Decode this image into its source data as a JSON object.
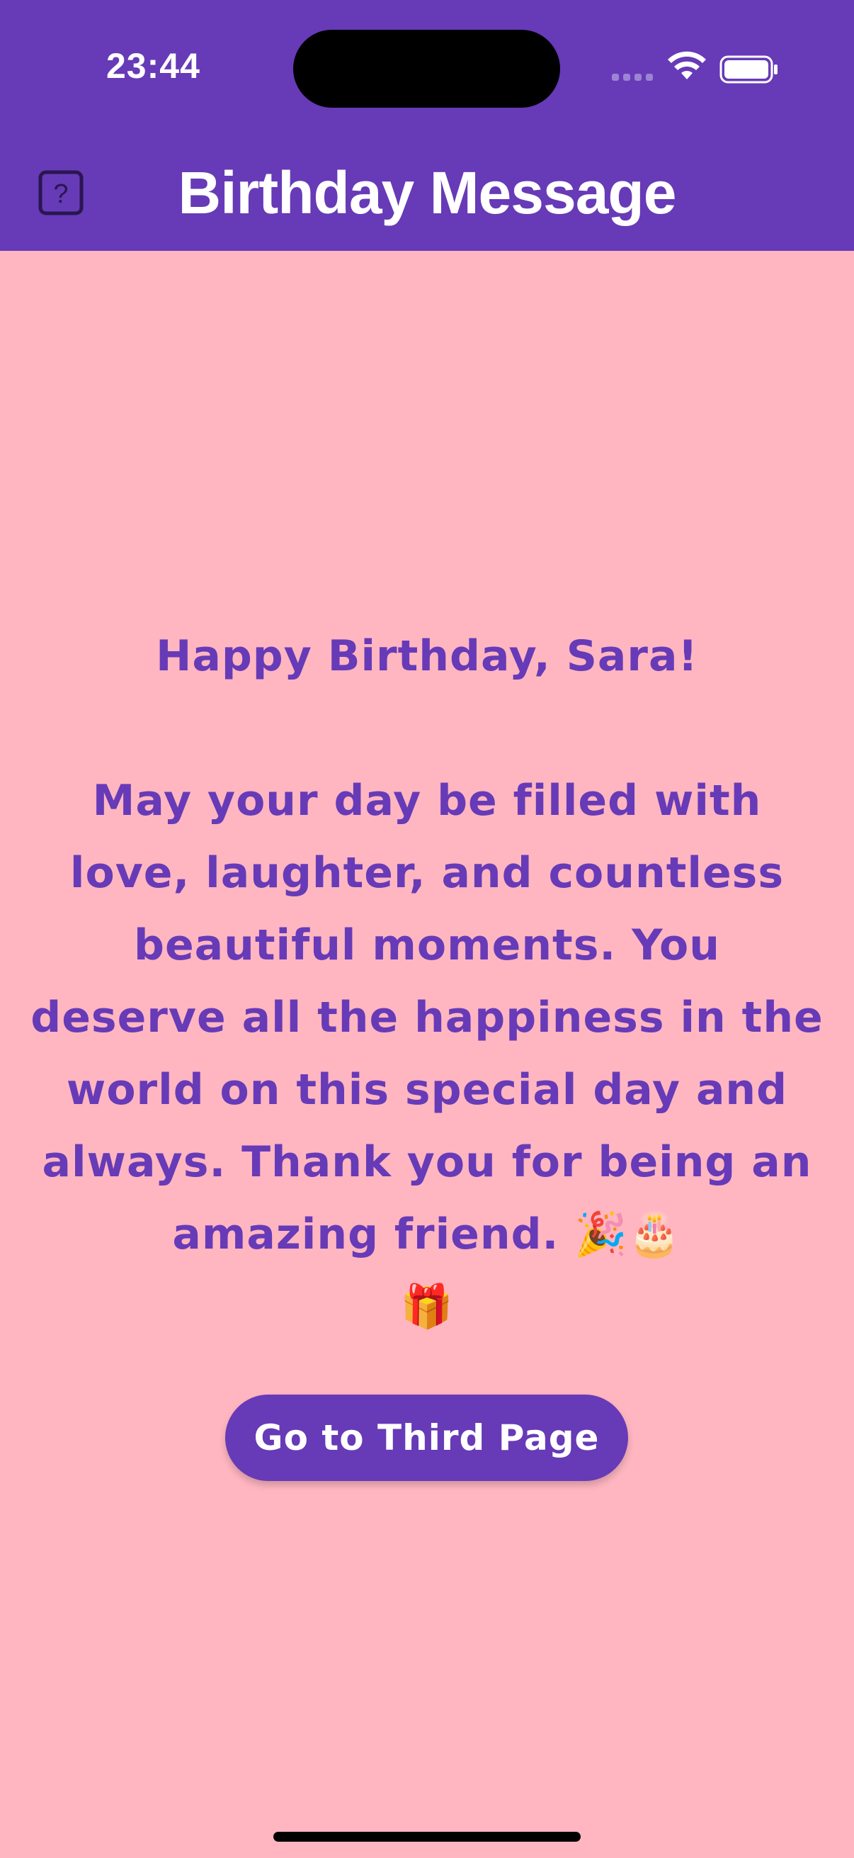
{
  "status_bar": {
    "time": "23:44",
    "icons": [
      "cellular-signal-icon",
      "wifi-icon",
      "battery-icon"
    ]
  },
  "app_bar": {
    "title": "Birthday Message",
    "leading_icon": "help-icon",
    "background_color": "#673AB7"
  },
  "message": {
    "heading": "Happy Birthday, Sara!",
    "body": "May your day be filled with love, laughter, and countless beautiful moments. You deserve all the happiness in the world on this special day and always. Thank you for being an amazing friend. 🎉🎂\n🎁",
    "text_color": "#673AB7"
  },
  "button": {
    "label": "Go to Third Page"
  },
  "theme": {
    "page_background": "#FFB6C1",
    "primary": "#673AB7"
  }
}
